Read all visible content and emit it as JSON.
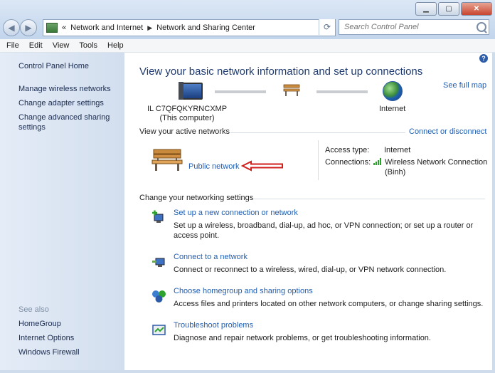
{
  "window": {
    "buttons": {
      "minimize": "▁",
      "maximize": "▢",
      "close": "✕"
    }
  },
  "address": {
    "recent": "«",
    "crumb1": "Network and Internet",
    "crumb2": "Network and Sharing Center",
    "sep": "▶"
  },
  "search": {
    "placeholder": "Search Control Panel"
  },
  "menu": [
    "File",
    "Edit",
    "View",
    "Tools",
    "Help"
  ],
  "left_pane": {
    "home": "Control Panel Home",
    "links": [
      "Manage wireless networks",
      "Change adapter settings",
      "Change advanced sharing",
      "settings"
    ],
    "see_also_title": "See also",
    "see_also": [
      "HomeGroup",
      "Internet Options",
      "Windows Firewall"
    ]
  },
  "main": {
    "title": "View your basic network information and set up connections",
    "see_full_map": "See full map",
    "computer_name": "IL C7QFQKYRNCXMP",
    "computer_label": "(This computer)",
    "internet_label": "Internet",
    "active_title": "View your active networks",
    "connect_disconnect": "Connect or disconnect",
    "network_name": "Public network",
    "access_type_label": "Access type:",
    "access_type_value": "Internet",
    "connections_label": "Connections:",
    "connection_name_1": "Wireless Network Connection",
    "connection_name_2": "(Binh)",
    "change_title": "Change your networking settings",
    "tasks": [
      {
        "link": "Set up a new connection or network",
        "desc": "Set up a wireless, broadband, dial-up, ad hoc, or VPN connection; or set up a router or access point."
      },
      {
        "link": "Connect to a network",
        "desc": "Connect or reconnect to a wireless, wired, dial-up, or VPN network connection."
      },
      {
        "link": "Choose homegroup and sharing options",
        "desc": "Access files and printers located on other network computers, or change sharing settings."
      },
      {
        "link": "Troubleshoot problems",
        "desc": "Diagnose and repair network problems, or get troubleshooting information."
      }
    ]
  },
  "colors": {
    "link": "#1f5eb3",
    "heading": "#1e3a6e",
    "annotation_arrow": "#d0201e"
  }
}
